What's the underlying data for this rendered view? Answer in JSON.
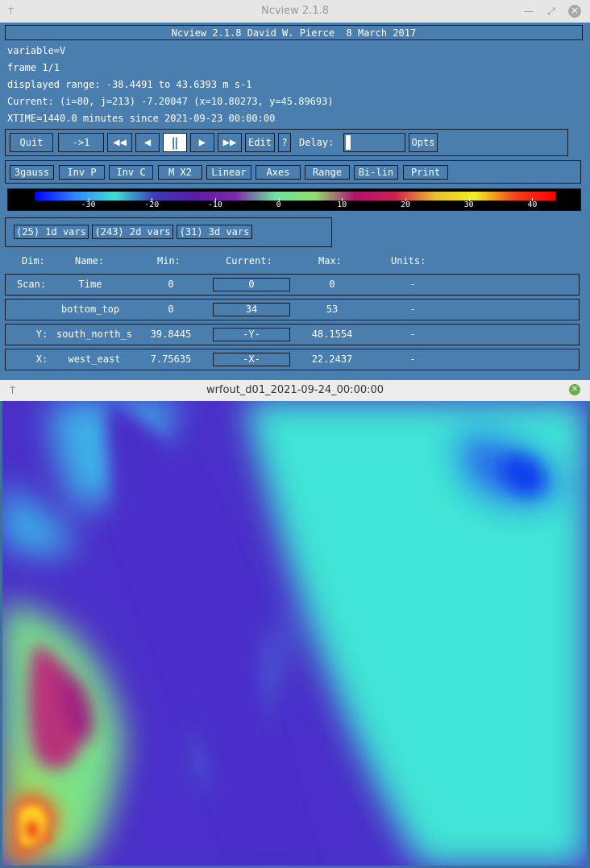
{
  "main_window": {
    "title": "Ncview 2.1.8",
    "pin_icon": "pin-icon",
    "controls": [
      "minimize-icon",
      "maximize-icon",
      "close-icon"
    ]
  },
  "info": {
    "banner": "Ncview 2.1.8 David W. Pierce  8 March 2017",
    "variable": "variable=V",
    "frame": "frame 1/1",
    "range": "displayed range: -38.4491 to 43.6393 m s-1",
    "current": "Current: (i=80, j=213) -7.20047 (x=10.80273, y=45.89693)",
    "xtime": "XTIME=1440.0 minutes since 2021-09-23 00:00:00"
  },
  "nav": {
    "quit": "Quit",
    "to_first": "->1",
    "rewind_icon": "fast-rewind-icon",
    "back_icon": "step-back-icon",
    "pause_icon": "pause-icon",
    "forward_icon": "play-icon",
    "ffwd_icon": "fast-forward-icon",
    "edit": "Edit",
    "help": "?",
    "delay_label": "Delay:",
    "delay_value": 0,
    "opts": "Opts"
  },
  "options": [
    "3gauss",
    "Inv P",
    "Inv C",
    "M X2",
    "Linear",
    "Axes",
    "Range",
    "Bi-lin",
    "Print"
  ],
  "colorbar": {
    "ticks": [
      "-30",
      "-20",
      "-10",
      "0",
      "10",
      "20",
      "30",
      "40"
    ],
    "min": -38.4491,
    "max": 43.6393,
    "colors": [
      "#0000ff",
      "#2f86ff",
      "#40e0d0",
      "#3a3ab8",
      "#5a1da5",
      "#7c2aa5",
      "#72e0a0",
      "#90e070",
      "#b01070",
      "#cc2050",
      "#e8c030",
      "#f0f020",
      "#f04020",
      "#ff0000"
    ]
  },
  "var_buttons": [
    "(25) 1d vars",
    "(243) 2d vars",
    "(31) 3d vars"
  ],
  "table": {
    "headers": {
      "dim": "Dim:",
      "name": "Name:",
      "min": "Min:",
      "current": "Current:",
      "max": "Max:",
      "units": "Units:"
    },
    "rows": [
      {
        "dim": "Scan:",
        "name": "Time",
        "min": "0",
        "current": "0",
        "max": "0",
        "units": "-"
      },
      {
        "dim": "",
        "name": "bottom_top",
        "min": "0",
        "current": "34",
        "max": "53",
        "units": "-"
      },
      {
        "dim": "Y:",
        "name": "south_north_s",
        "min": "39.8445",
        "current": "-Y-",
        "max": "48.1554",
        "units": "-"
      },
      {
        "dim": "X:",
        "name": "west_east",
        "min": "7.75635",
        "current": "-X-",
        "max": "22.2437",
        "units": "-"
      }
    ]
  },
  "plot_window": {
    "title": "wrfout_d01_2021-09-24_00:00:00",
    "pin_icon": "pin-icon",
    "close_icon": "close-icon"
  }
}
